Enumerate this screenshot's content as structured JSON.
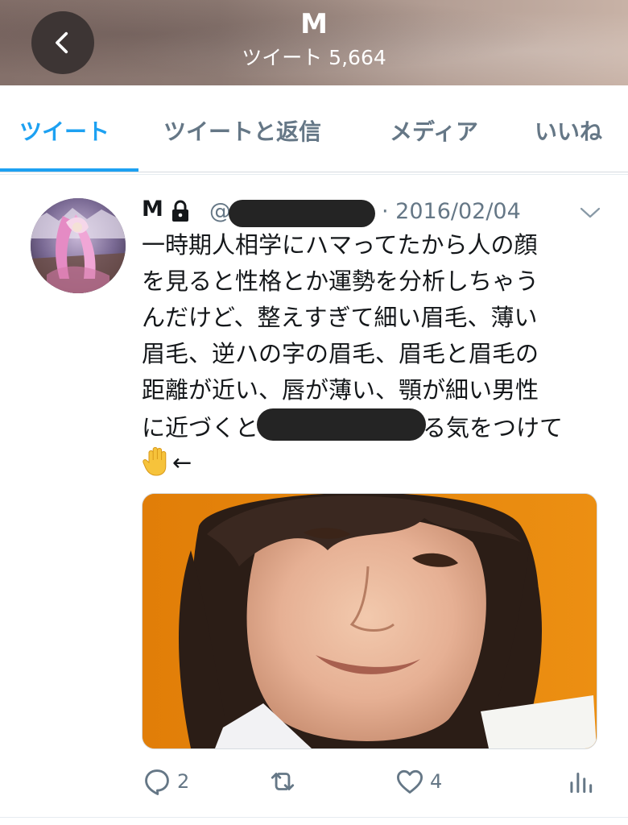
{
  "header": {
    "title": "M",
    "subtitle": "ツイート 5,664",
    "back_icon": "chevron-left-icon"
  },
  "tabs": [
    {
      "label": "ツイート",
      "active": true
    },
    {
      "label": "ツイートと返信",
      "active": false
    },
    {
      "label": "メディア",
      "active": false
    },
    {
      "label": "いいね",
      "active": false
    }
  ],
  "tweet": {
    "author_name": "M",
    "protected_icon": "lock-icon",
    "handle_prefix": "@",
    "date": "· 2016/02/04",
    "menu_icon": "chevron-down-icon",
    "text_lines": [
      "一時期人相学にハマってたから人の顔",
      "を見ると性格とか運勢を分析しちゃう",
      "んだけど、整えすぎて細い眉毛、薄い",
      "眉毛、逆ハの字の眉毛、眉毛と眉毛の",
      "距離が近い、唇が薄い、顎が細い男性"
    ],
    "line6_before": "に近づくと",
    "line6_after": "る気をつけて",
    "line7_after": "←",
    "actions": {
      "reply_count": "2",
      "retweet_count": "",
      "like_count": "4"
    }
  },
  "colors": {
    "accent": "#1da1f2",
    "muted": "#657786",
    "text": "#14171a",
    "redaction": "#242424",
    "media_background": "#e8860a"
  }
}
